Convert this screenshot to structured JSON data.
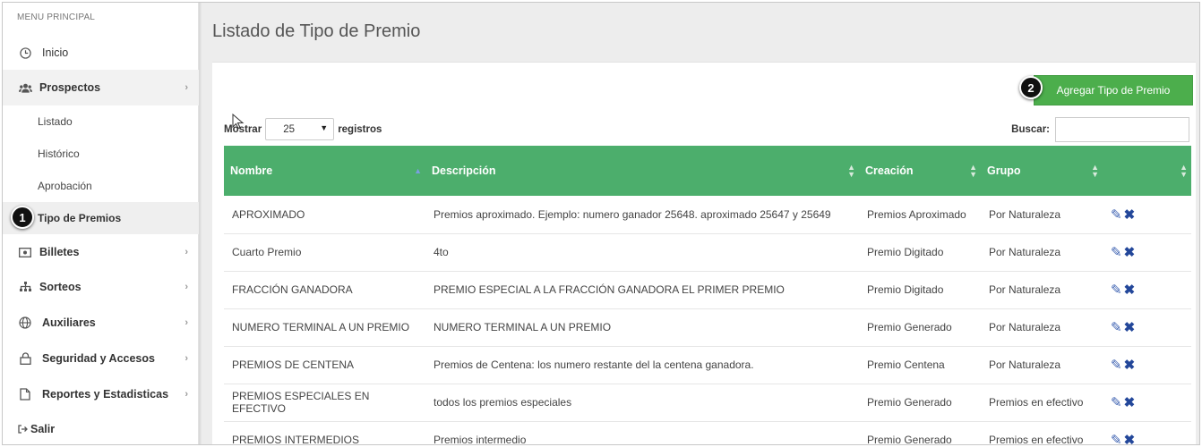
{
  "sidebar": {
    "menu_title": "MENU PRINCIPAL",
    "items": [
      {
        "label": "Inicio",
        "icon": "clock-icon"
      },
      {
        "label": "Prospectos",
        "icon": "users-icon"
      },
      {
        "label": "Listado"
      },
      {
        "label": "Histórico"
      },
      {
        "label": "Aprobación"
      },
      {
        "label": "Tipo de Premios"
      },
      {
        "label": "Billetes",
        "icon": "money-icon"
      },
      {
        "label": "Sorteos",
        "icon": "sitemap-icon"
      },
      {
        "label": "Auxiliares",
        "icon": "globe-icon"
      },
      {
        "label": "Seguridad y Accesos",
        "icon": "lock-icon"
      },
      {
        "label": "Reportes y Estadisticas",
        "icon": "file-icon"
      },
      {
        "label": "Salir",
        "icon": "sign-out-icon"
      }
    ]
  },
  "page": {
    "title": "Listado de Tipo de Premio",
    "add_button": "Agregar Tipo de Premio"
  },
  "steps": {
    "one": "1",
    "two": "2"
  },
  "table_controls": {
    "show_prefix": "Mostrar",
    "page_length": "25",
    "show_suffix": "registros",
    "search_label": "Buscar:"
  },
  "table": {
    "columns": [
      "Nombre",
      "Descripción",
      "Creación",
      "Grupo",
      ""
    ],
    "rows": [
      [
        "APROXIMADO",
        "Premios aproximado. Ejemplo: numero ganador 25648. aproximado 25647 y 25649",
        "Premios Aproximado",
        "Por Naturaleza"
      ],
      [
        "Cuarto Premio",
        "4to",
        "Premio Digitado",
        "Por Naturaleza"
      ],
      [
        "FRACCIÓN GANADORA",
        "PREMIO ESPECIAL A LA FRACCIÓN GANADORA EL PRIMER PREMIO",
        "Premio Digitado",
        "Por Naturaleza"
      ],
      [
        "NUMERO TERMINAL A UN PREMIO",
        "NUMERO TERMINAL A UN PREMIO",
        "Premio Generado",
        "Por Naturaleza"
      ],
      [
        "PREMIOS DE CENTENA",
        "Premios de Centena: los numero restante del la centena ganadora.",
        "Premio Centena",
        "Por Naturaleza"
      ],
      [
        "PREMIOS ESPECIALES EN EFECTIVO",
        "todos los premios especiales",
        "Premio Generado",
        "Premios en efectivo"
      ],
      [
        "PREMIOS INTERMEDIOS",
        "Premios intermedio",
        "Premio Generado",
        "Premios en efectivo"
      ]
    ]
  },
  "colors": {
    "accent_green": "#4cae6c",
    "button_green": "#4cae4c",
    "action_blue": "#23479a"
  }
}
